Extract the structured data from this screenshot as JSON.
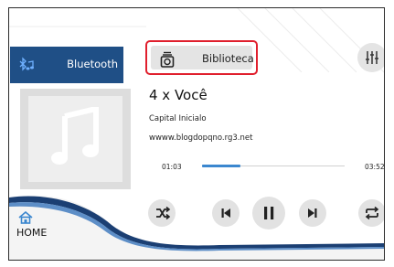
{
  "source_tab": {
    "label": "Bluetooth",
    "icon": "bluetooth-music-icon"
  },
  "library_button": {
    "label": "Biblioteca",
    "icon": "library-icon"
  },
  "equalizer_button": {
    "icon": "equalizer-sliders-icon"
  },
  "track": {
    "title": "4 x Você",
    "artist": "Capital Inicialo",
    "url": "wwww.blogdopqno.rg3.net"
  },
  "playback": {
    "current_time": "01:03",
    "total_time": "03:52",
    "progress_fraction": 0.271
  },
  "home": {
    "label": "HOME",
    "icon": "home-icon"
  },
  "controls": [
    {
      "name": "shuffle-button",
      "icon": "shuffle-icon"
    },
    {
      "name": "previous-button",
      "icon": "skip-previous-icon"
    },
    {
      "name": "pause-button",
      "icon": "pause-icon"
    },
    {
      "name": "next-button",
      "icon": "skip-next-icon"
    },
    {
      "name": "repeat-button",
      "icon": "repeat-icon"
    }
  ],
  "colors": {
    "bluetooth_tab": "#1f4f86",
    "highlight_border": "#e01f2d",
    "progress": "#3b87cf",
    "wave_dark": "#1b3f73",
    "home_icon": "#3b87cf"
  }
}
